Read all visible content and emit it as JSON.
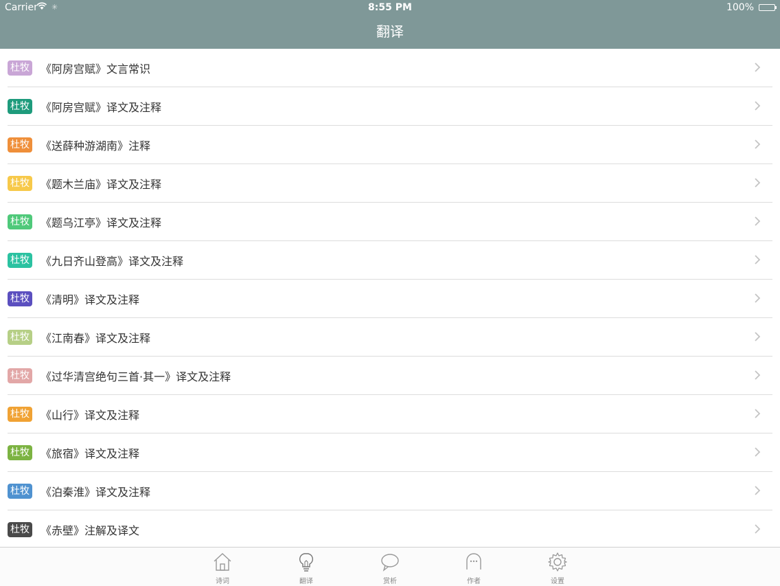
{
  "status": {
    "carrier": "Carrier",
    "time": "8:55 PM",
    "battery": "100%"
  },
  "nav": {
    "title": "翻译"
  },
  "colors": {
    "navbar": "#7f9898",
    "text": "#333333",
    "tab_text": "#888888"
  },
  "list": [
    {
      "badge": "杜牧",
      "badge_color": "#c9a6d6",
      "title": "《阿房宫赋》文言常识"
    },
    {
      "badge": "杜牧",
      "badge_color": "#1e9b7c",
      "title": "《阿房宫赋》译文及注释"
    },
    {
      "badge": "杜牧",
      "badge_color": "#ef8f3a",
      "title": "《送薛种游湖南》注释"
    },
    {
      "badge": "杜牧",
      "badge_color": "#f7c94a",
      "title": "《题木兰庙》译文及注释"
    },
    {
      "badge": "杜牧",
      "badge_color": "#4fc97a",
      "title": "《题乌江亭》译文及注释"
    },
    {
      "badge": "杜牧",
      "badge_color": "#2bc2a1",
      "title": "《九日齐山登高》译文及注释"
    },
    {
      "badge": "杜牧",
      "badge_color": "#5b4fbf",
      "title": "《清明》译文及注释"
    },
    {
      "badge": "杜牧",
      "badge_color": "#b6cf86",
      "title": "《江南春》译文及注释"
    },
    {
      "badge": "杜牧",
      "badge_color": "#e2a7a7",
      "title": "《过华清宫绝句三首·其一》译文及注释"
    },
    {
      "badge": "杜牧",
      "badge_color": "#f0a234",
      "title": "《山行》译文及注释"
    },
    {
      "badge": "杜牧",
      "badge_color": "#7cb342",
      "title": "《旅宿》译文及注释"
    },
    {
      "badge": "杜牧",
      "badge_color": "#4f92d0",
      "title": "《泊秦淮》译文及注释"
    },
    {
      "badge": "杜牧",
      "badge_color": "#4a4a4a",
      "title": "《赤壁》注解及译文"
    }
  ],
  "tabs": [
    {
      "label": "诗词",
      "icon": "home-icon"
    },
    {
      "label": "翻译",
      "icon": "lightbulb-icon"
    },
    {
      "label": "赏析",
      "icon": "speech-bubble-icon"
    },
    {
      "label": "作者",
      "icon": "face-icon"
    },
    {
      "label": "设置",
      "icon": "gear-icon"
    }
  ]
}
